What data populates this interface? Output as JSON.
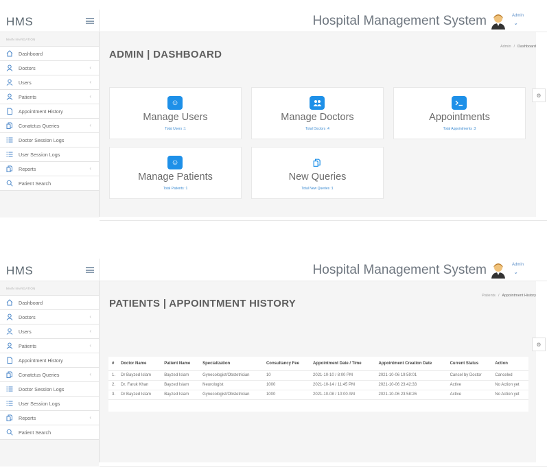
{
  "app": {
    "brand": "HMS",
    "title": "Hospital Management System",
    "user": "Admin"
  },
  "sidebar": {
    "header": "MAIN NAVIGATION",
    "items": [
      {
        "label": "Dashboard",
        "icon": "home-icon",
        "has_submenu": false
      },
      {
        "label": "Doctors",
        "icon": "user-icon",
        "has_submenu": true
      },
      {
        "label": "Users",
        "icon": "user-icon",
        "has_submenu": true
      },
      {
        "label": "Patients",
        "icon": "user-icon",
        "has_submenu": true
      },
      {
        "label": "Appointment History",
        "icon": "file-icon",
        "has_submenu": false
      },
      {
        "label": "Conatctus Queries",
        "icon": "files-icon",
        "has_submenu": true
      },
      {
        "label": "Doctor Session Logs",
        "icon": "list-icon",
        "has_submenu": false
      },
      {
        "label": "User Session Logs",
        "icon": "list-icon",
        "has_submenu": false
      },
      {
        "label": "Reports",
        "icon": "files-icon",
        "has_submenu": true
      },
      {
        "label": "Patient Search",
        "icon": "search-icon",
        "has_submenu": false
      }
    ]
  },
  "dashboard": {
    "title": "ADMIN | DASHBOARD",
    "breadcrumb": {
      "parent": "Admin",
      "sep": "/",
      "current": "Dashboard"
    },
    "cards": [
      {
        "title": "Manage Users",
        "subtitle": "Total Users :1",
        "icon": "smile-icon"
      },
      {
        "title": "Manage Doctors",
        "subtitle": "Total Doctors :4",
        "icon": "users-icon"
      },
      {
        "title": "Appointments",
        "subtitle": "Total Appointments :3",
        "icon": "terminal-icon"
      },
      {
        "title": "Manage Patients",
        "subtitle": "Total Patients :1",
        "icon": "smile-icon"
      },
      {
        "title": "New Queries",
        "subtitle": "Total New Queries :1",
        "icon": "files-icon"
      }
    ]
  },
  "history": {
    "title": "PATIENTS | APPOINTMENT HISTORY",
    "breadcrumb": {
      "parent": "Patients",
      "sep": "/",
      "current": "Appointment History"
    },
    "columns": [
      "#",
      "Doctor Name",
      "Patient Name",
      "Specialization",
      "Consultancy Fee",
      "Appointment Date / Time",
      "Appointment Creation Date",
      "Current Status",
      "Action"
    ],
    "rows": [
      [
        "1.",
        "Dr Bayzed Islam",
        "Bayzed Islam",
        "Gynecologist/Obstetrician",
        "10",
        "2021-10-10 / 8:00 PM",
        "2021-10-06 19:59:01",
        "Cancel by Doctor",
        "Canceled"
      ],
      [
        "2.",
        "Dr. Faruk Khan",
        "Bayzed Islam",
        "Neurologist",
        "1000",
        "2021-10-14 / 11:45 PM",
        "2021-10-06 23:42:33",
        "Active",
        "No Action yet"
      ],
      [
        "3.",
        "Dr Bayzed Islam",
        "Bayzed Islam",
        "Gynecologist/Obstetrician",
        "1000",
        "2021-10-08 / 10:00 AM",
        "2021-10-06 23:58:26",
        "Active",
        "No Action yet"
      ]
    ]
  }
}
